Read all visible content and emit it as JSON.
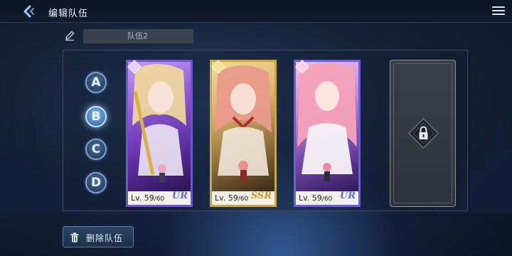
{
  "header": {
    "title": "编辑队伍"
  },
  "team": {
    "name": "队伍2",
    "slots": [
      "A",
      "B",
      "C",
      "D"
    ],
    "active_slot": "B"
  },
  "cards": [
    {
      "level_prefix": "Lv. ",
      "level": "59",
      "max_level": "/60",
      "rarity": "UR",
      "rarity_color": "#5b6bdc",
      "frame_color": "#6e58c8"
    },
    {
      "level_prefix": "Lv. ",
      "level": "59",
      "max_level": "/60",
      "rarity": "SSR",
      "rarity_color": "#c8962a",
      "frame_color": "#c9a64a"
    },
    {
      "level_prefix": "Lv. ",
      "level": "59",
      "max_level": "/60",
      "rarity": "UR",
      "rarity_color": "#5b6bdc",
      "frame_color": "#6c60d0"
    }
  ],
  "locked_slot": {
    "icon": "lock-icon"
  },
  "footer": {
    "delete_label": "删除队伍"
  },
  "colors": {
    "accent": "#7ea3cc",
    "active_slot_glow": "#cfe6ff",
    "panel_border": "#3c4b63"
  }
}
